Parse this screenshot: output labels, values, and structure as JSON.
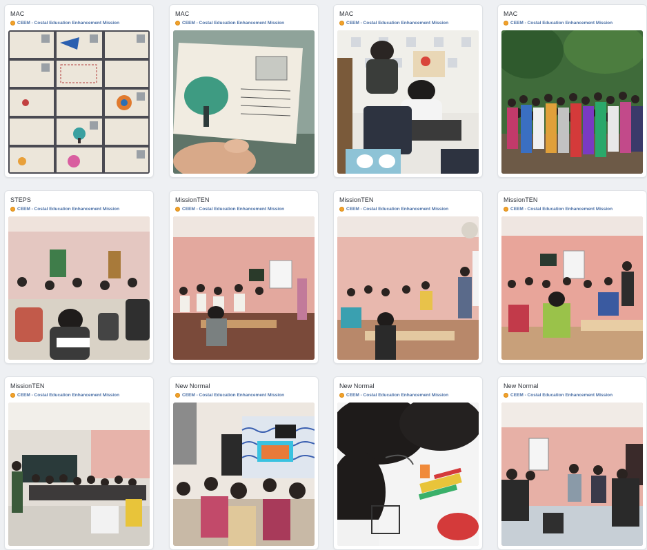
{
  "cards": [
    {
      "title": "MAC",
      "org": "CEEM - Costal Education Enhancement Mission",
      "photo": "postcards-grid-photo"
    },
    {
      "title": "MAC",
      "org": "CEEM - Costal Education Enhancement Mission",
      "photo": "postcard-in-hand-photo"
    },
    {
      "title": "MAC",
      "org": "CEEM - Costal Education Enhancement Mission",
      "photo": "children-drawing-photo"
    },
    {
      "title": "MAC",
      "org": "CEEM - Costal Education Enhancement Mission",
      "photo": "group-outdoors-photo"
    },
    {
      "title": "STEPS",
      "org": "CEEM - Costal Education Enhancement Mission",
      "photo": "exam-hall-photo"
    },
    {
      "title": "MissionTEN",
      "org": "CEEM - Costal Education Enhancement Mission",
      "photo": "classroom-photo"
    },
    {
      "title": "MissionTEN",
      "org": "CEEM - Costal Education Enhancement Mission",
      "photo": "classroom-photo"
    },
    {
      "title": "MissionTEN",
      "org": "CEEM - Costal Education Enhancement Mission",
      "photo": "classroom-photo"
    },
    {
      "title": "MissionTEN",
      "org": "CEEM - Costal Education Enhancement Mission",
      "photo": "classroom-photo"
    },
    {
      "title": "New Normal",
      "org": "CEEM - Costal Education Enhancement Mission",
      "photo": "tv-class-photo"
    },
    {
      "title": "New Normal",
      "org": "CEEM - Costal Education Enhancement Mission",
      "photo": "drawing-table-photo"
    },
    {
      "title": "New Normal",
      "org": "CEEM - Costal Education Enhancement Mission",
      "photo": "meeting-room-photo"
    }
  ],
  "colors": {
    "org_text": "#4a6fa5",
    "org_icon": "#f2a12b",
    "card_bg": "#ffffff",
    "page_bg": "#eef0f3"
  }
}
